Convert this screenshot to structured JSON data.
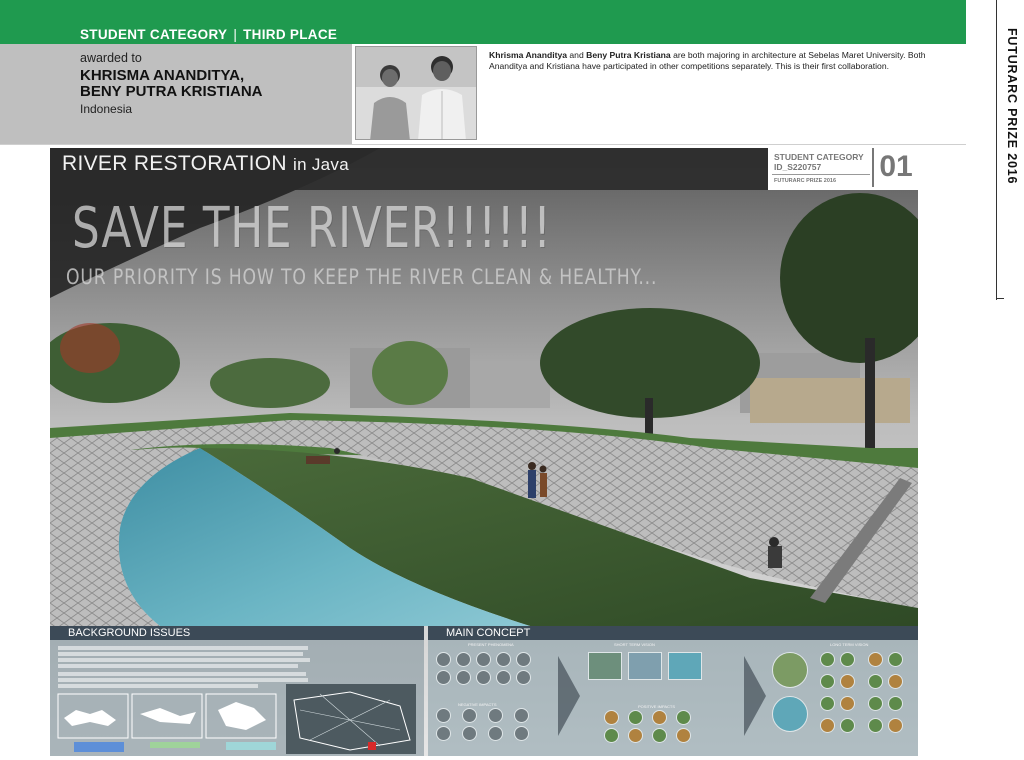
{
  "header": {
    "category_label": "STUDENT CATEGORY",
    "separator": "|",
    "place_label": "THIRD PLACE"
  },
  "award": {
    "awarded_to": "awarded to",
    "names_line1": "KHRISMA ANANDITYA,",
    "names_line2": "BENY PUTRA KRISTIANA",
    "country": "Indonesia"
  },
  "bio": {
    "name1": "Khrisma Ananditya",
    "and": "and",
    "name2": "Beny Putra Kristiana",
    "text": "are both majoring in architecture at Sebelas Maret University. Both Ananditya and Kristiana have participated in other competitions separately. This is their first collaboration."
  },
  "sidebar": {
    "vertical_title": "FUTURARC PRIZE 2016"
  },
  "poster": {
    "title_main": "RIVER RESTORATION",
    "title_sub": "in Java",
    "headline": "SAVE THE RIVER!!!!!!",
    "tagline": "OUR PRIORITY IS HOW TO KEEP THE RIVER CLEAN & HEALTHY...",
    "id_category": "STUDENT CATEGORY",
    "id_number": "ID_S220757",
    "id_prize": "FUTURARC PRIZE 2016",
    "sheet_number": "01",
    "section_background": "BACKGROUND ISSUES",
    "section_concept": "MAIN CONCEPT",
    "label_present": "PRESENT PHENOMENA",
    "label_short_term": "SHORT TERM VISION",
    "label_long_term": "LONG TERM VISION",
    "label_negative": "NEGATIVE IMPACTS",
    "label_positive": "POSITIVE IMPACTS"
  },
  "colors": {
    "header_green": "#1f9a4f",
    "award_gray": "#bfbfbf",
    "section_bar": "#3c4a57",
    "river_blue": "#5fa7b8"
  },
  "icons": [
    "chevron-right-icon",
    "down-arrow-icon"
  ]
}
